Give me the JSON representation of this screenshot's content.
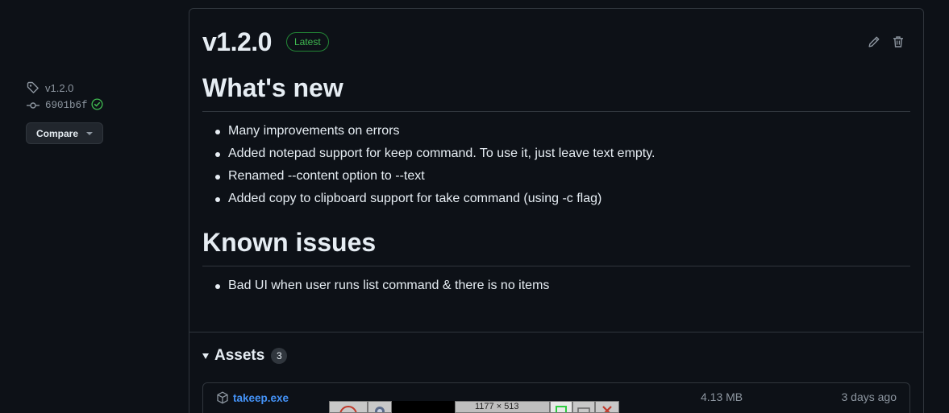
{
  "sidebar": {
    "tag": "v1.2.0",
    "commit": "6901b6f",
    "compare_label": "Compare"
  },
  "release": {
    "version": "v1.2.0",
    "badge": "Latest",
    "sections": {
      "whats_new": {
        "title": "What's new",
        "items": [
          "Many improvements on errors",
          "Added notepad support for keep command. To use it, just leave text empty.",
          "Renamed --content option to --text",
          "Added copy to clipboard support for take command (using -c flag)"
        ]
      },
      "known_issues": {
        "title": "Known issues",
        "items": [
          "Bad UI when user runs list command & there is no items"
        ]
      }
    }
  },
  "assets": {
    "title": "Assets",
    "count": "3",
    "items": [
      {
        "name": "takeep.exe",
        "size": "4.13 MB",
        "date": "3 days ago"
      }
    ]
  },
  "overlay": {
    "dimensions": "1177 × 513"
  },
  "colors": {
    "background": "#0d1117",
    "border": "#30363d",
    "accent_link": "#4493f8",
    "success": "#3fb950"
  }
}
